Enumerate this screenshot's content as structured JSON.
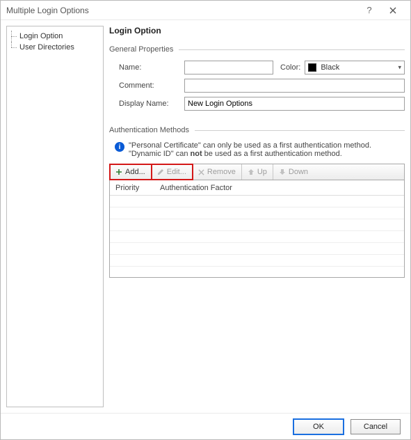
{
  "window": {
    "title": "Multiple Login Options"
  },
  "sidebar": {
    "items": [
      {
        "label": "Login Option"
      },
      {
        "label": "User Directories"
      }
    ]
  },
  "content": {
    "heading": "Login Option",
    "general": {
      "section_label": "General Properties",
      "name_label": "Name:",
      "name_value": "",
      "color_label": "Color:",
      "color_value": "Black",
      "color_hex": "#000000",
      "comment_label": "Comment:",
      "comment_value": "",
      "display_name_label": "Display Name:",
      "display_name_value": "New Login Options"
    },
    "auth": {
      "section_label": "Authentication Methods",
      "info_line1": "\"Personal Certificate\" can only be used as a first authentication method.",
      "info_line2_pre": "\"Dynamic ID\" can ",
      "info_line2_bold": "not",
      "info_line2_post": " be used as a first authentication method.",
      "toolbar": {
        "add": "Add...",
        "edit": "Edit...",
        "remove": "Remove",
        "up": "Up",
        "down": "Down"
      },
      "grid": {
        "col_priority": "Priority",
        "col_factor": "Authentication Factor",
        "rows": []
      }
    }
  },
  "footer": {
    "ok": "OK",
    "cancel": "Cancel"
  }
}
